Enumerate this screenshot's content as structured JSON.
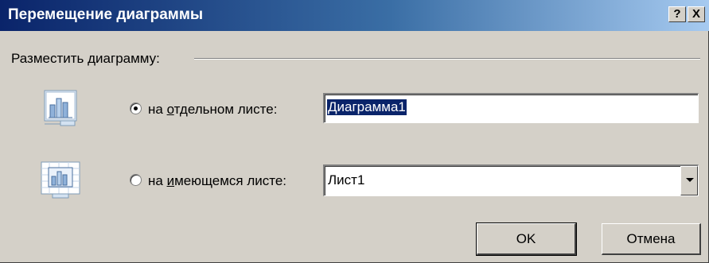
{
  "window": {
    "title": "Перемещение диаграммы",
    "help_button": "?",
    "close_button": "X"
  },
  "group": {
    "label": "Разместить диаграмму:"
  },
  "options": [
    {
      "label_prefix": "на ",
      "label_access_key": "о",
      "label_rest": "тдельном листе:",
      "selected": true,
      "value": "Диаграмма1",
      "icon": "chart-sheet-icon"
    },
    {
      "label_prefix": "на ",
      "label_access_key": "и",
      "label_rest": "меющемся листе:",
      "selected": false,
      "value": "Лист1",
      "icon": "embedded-chart-icon"
    }
  ],
  "buttons": {
    "ok": "OK",
    "cancel": "Отмена"
  }
}
